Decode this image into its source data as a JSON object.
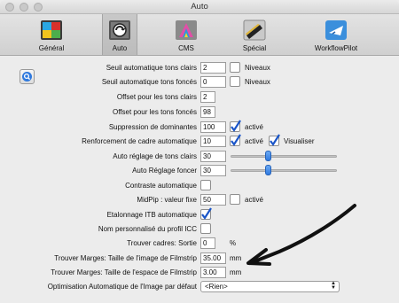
{
  "window": {
    "title": "Auto"
  },
  "toolbar": {
    "tabs": [
      {
        "label": "Général",
        "icon": "general-icon"
      },
      {
        "label": "Auto",
        "icon": "auto-icon",
        "selected": true
      },
      {
        "label": "CMS",
        "icon": "cms-icon"
      },
      {
        "label": "Spécial",
        "icon": "special-icon"
      },
      {
        "label": "WorkflowPilot",
        "icon": "workflowpilot-icon"
      }
    ]
  },
  "colors": {
    "accent": "#2f79de",
    "checkmark": "#1a55c8"
  },
  "settings": {
    "seuil_clairs": {
      "label": "Seuil automatique tons clairs",
      "value": "2",
      "check_label": "Niveaux",
      "checked": false
    },
    "seuil_fonces": {
      "label": "Seuil automatique tons foncés",
      "value": "0",
      "check_label": "Niveaux",
      "checked": false
    },
    "offset_clairs": {
      "label": "Offset pour les tons clairs",
      "value": "2"
    },
    "offset_fonces": {
      "label": "Offset pour les tons foncés",
      "value": "98"
    },
    "dominantes": {
      "label": "Suppression de dominantes",
      "value": "100",
      "check_label": "activé",
      "checked": true
    },
    "cadre": {
      "label": "Renforcement de cadre automatique",
      "value": "10",
      "check_label": "activé",
      "checked": true,
      "check2_label": "Visualiser",
      "checked2": true
    },
    "tons_clairs": {
      "label": "Auto réglage de tons clairs",
      "value": "30",
      "slider_level": 0.3
    },
    "foncer": {
      "label": "Auto Réglage foncer",
      "value": "30",
      "slider_level": 0.3
    },
    "contraste": {
      "label": "Contraste automatique",
      "checked": false
    },
    "midpip": {
      "label": "MidPip : valeur fixe",
      "value": "50",
      "check_label": "activé",
      "checked": false
    },
    "etalonnage": {
      "label": "Etalonnage ITB automatique",
      "checked": true
    },
    "nom_icc": {
      "label": "Nom personnalisé du profil ICC",
      "checked": false
    },
    "cadres_sortie": {
      "label": "Trouver cadres: Sortie",
      "value": "0",
      "unit": "%"
    },
    "marges_image": {
      "label": "Trouver Marges: Taille de l'image de Filmstrip",
      "value": "35.00",
      "unit": "mm"
    },
    "marges_espace": {
      "label": "Trouver Marges: Taille de l'espace de Filmstrip",
      "value": "3.00",
      "unit": "mm"
    },
    "optimisation": {
      "label": "Optimisation Automatique de l'Image par défaut",
      "selected": "<Rien>"
    }
  }
}
